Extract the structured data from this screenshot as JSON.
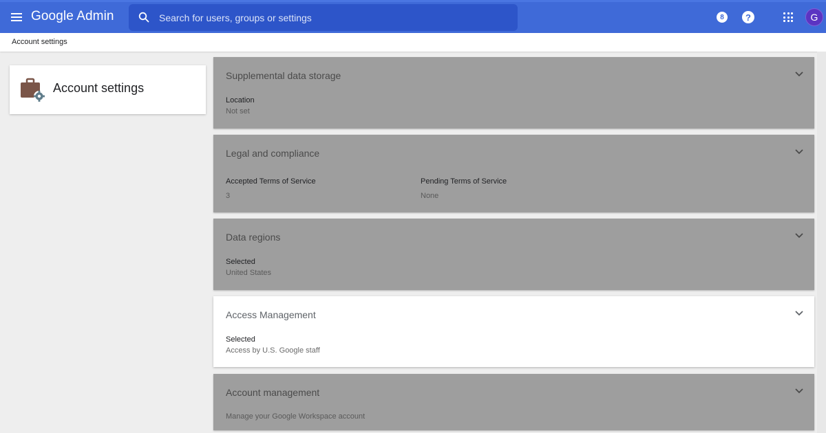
{
  "header": {
    "app_title": "Google Admin",
    "search_placeholder": "Search for users, groups or settings",
    "notification_count": "8",
    "help_glyph": "?",
    "avatar_initial": "G",
    "bar_color": "#3f6ad8",
    "avatar_color": "#5b34c2"
  },
  "breadcrumb": {
    "text": "Account settings"
  },
  "sidebar_card": {
    "title": "Account settings",
    "icon": "briefcase-gear-icon"
  },
  "sections": [
    {
      "title": "Supplemental data storage",
      "state": "dimmed",
      "fields": [
        {
          "label": "Location",
          "value": "Not set"
        }
      ]
    },
    {
      "title": "Legal and compliance",
      "state": "dimmed",
      "fields": [
        {
          "label": "Accepted Terms of Service",
          "value": "3"
        },
        {
          "label": "Pending Terms of Service",
          "value": "None"
        }
      ]
    },
    {
      "title": "Data regions",
      "state": "dimmed",
      "fields": [
        {
          "label": "Selected",
          "value": "United States"
        }
      ]
    },
    {
      "title": "Access Management",
      "state": "highlighted",
      "fields": [
        {
          "label": "Selected",
          "value": "Access by U.S. Google staff"
        }
      ]
    },
    {
      "title": "Account management",
      "state": "dimmed",
      "fields": [
        {
          "label": "",
          "value": "Manage your Google Workspace account"
        }
      ]
    }
  ],
  "colors": {
    "dimmed_panel": "#9e9e9e",
    "highlighted_panel": "#ffffff",
    "background": "#eeeeee"
  }
}
